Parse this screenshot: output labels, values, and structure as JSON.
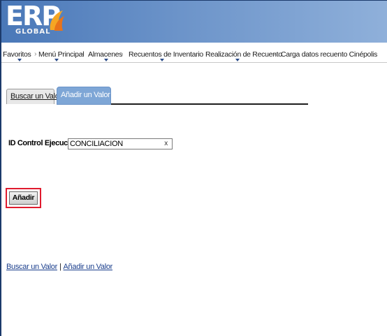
{
  "logo": {
    "text": "ERP",
    "subtext": "GLOBAL"
  },
  "nav": {
    "items": [
      {
        "label": "Favoritos",
        "has_menu": true
      },
      {
        "label": "Menú Principal",
        "has_menu": true
      },
      {
        "label": "Almacenes",
        "has_menu": true
      },
      {
        "label": "Recuentos de Inventario",
        "has_menu": true
      },
      {
        "label": "Realización de Recuento",
        "has_menu": true
      },
      {
        "label": "Carga datos recuento Cinépolis",
        "has_menu": false
      }
    ],
    "separator": "›"
  },
  "tabs": [
    {
      "label": "Buscar un Valor",
      "active": false
    },
    {
      "label": "Añadir un Valor",
      "active": true
    }
  ],
  "form": {
    "id_label": "ID Control Ejecución:",
    "id_value": "CONCILIACION",
    "clear_symbol": "x"
  },
  "add_button": {
    "label": "Añadir"
  },
  "bottom_links": [
    {
      "label": "Buscar un Valor"
    },
    {
      "label": "Añadir un Valor"
    }
  ],
  "colors": {
    "header": "#4a78b8",
    "active_tab": "#7ea6d6",
    "highlight": "#e01b2e",
    "link": "#1a3e8c"
  }
}
